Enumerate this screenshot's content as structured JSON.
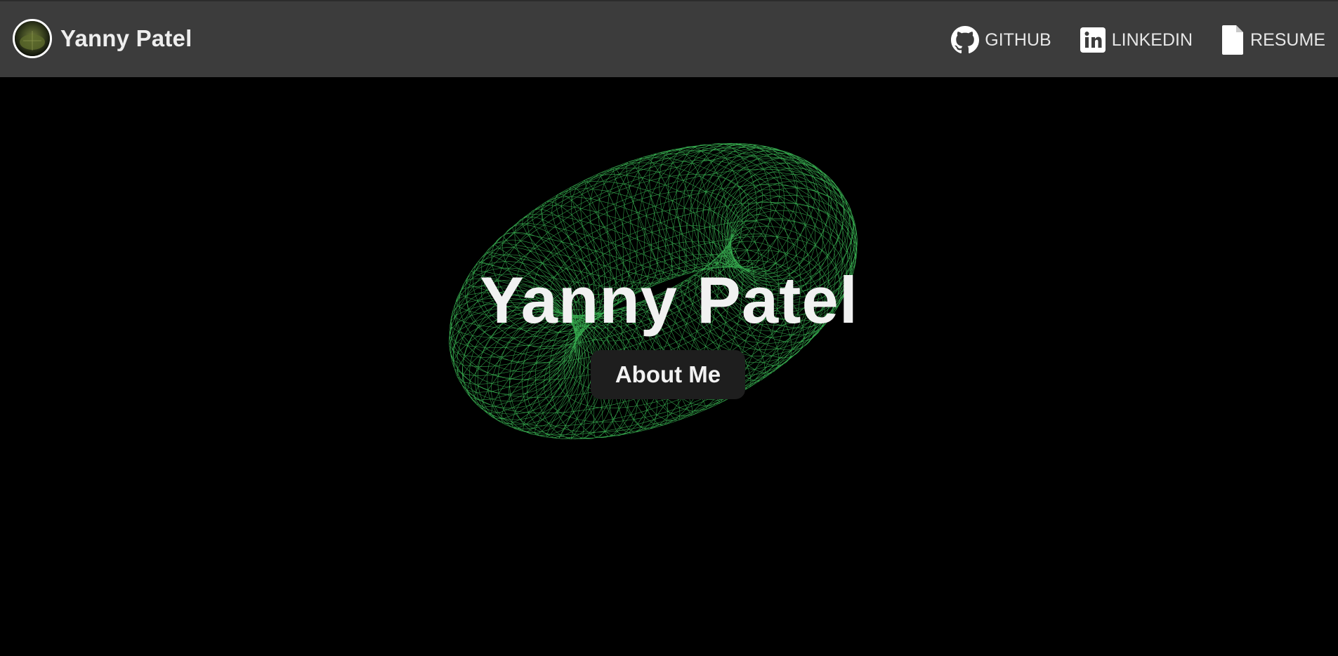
{
  "header": {
    "brand_name": "Yanny Patel",
    "avatar_icon": "avatar-photo",
    "links": [
      {
        "label": "GITHUB",
        "icon": "github-icon"
      },
      {
        "label": "LINKEDIN",
        "icon": "linkedin-icon"
      },
      {
        "label": "RESUME",
        "icon": "document-icon"
      }
    ]
  },
  "hero": {
    "title": "Yanny Patel",
    "button_label": "About Me",
    "torus_color": "#3ec45a"
  },
  "colors": {
    "navbar_bg": "#3c3c3c",
    "page_bg": "#000000",
    "button_bg": "#1e1e1e",
    "text": "#eeeeee"
  }
}
